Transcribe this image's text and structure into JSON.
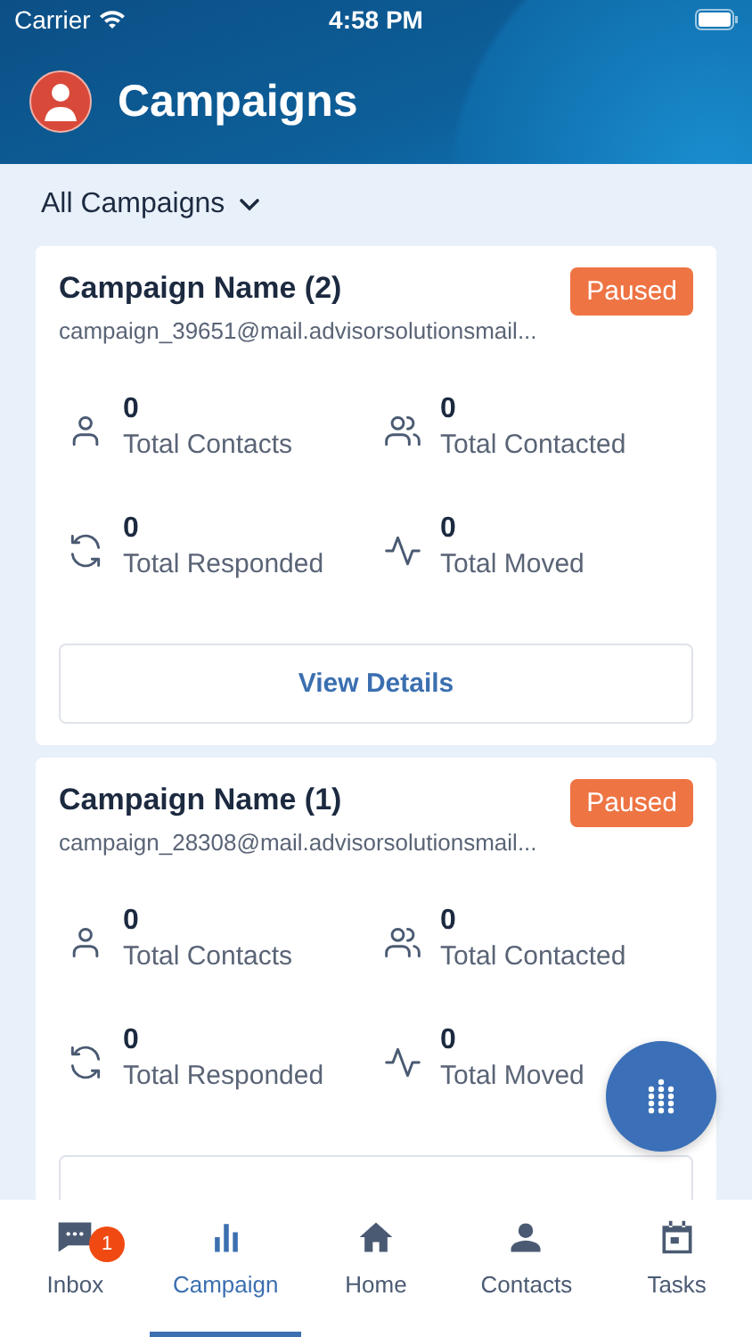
{
  "status_bar": {
    "carrier": "Carrier",
    "time": "4:58 PM"
  },
  "header": {
    "title": "Campaigns"
  },
  "filter": {
    "label": "All Campaigns"
  },
  "campaigns": [
    {
      "name": "Campaign Name (2)",
      "email": "campaign_39651@mail.advisorsolutionsmail...",
      "status": "Paused",
      "stats": [
        {
          "kind": "contact",
          "value": "0",
          "label": "Total Contacts"
        },
        {
          "kind": "contacted",
          "value": "0",
          "label": "Total Contacted"
        },
        {
          "kind": "responded",
          "value": "0",
          "label": "Total Responded"
        },
        {
          "kind": "moved",
          "value": "0",
          "label": "Total Moved"
        }
      ],
      "button": "View Details"
    },
    {
      "name": "Campaign Name (1)",
      "email": "campaign_28308@mail.advisorsolutionsmail...",
      "status": "Paused",
      "stats": [
        {
          "kind": "contact",
          "value": "0",
          "label": "Total Contacts"
        },
        {
          "kind": "contacted",
          "value": "0",
          "label": "Total Contacted"
        },
        {
          "kind": "responded",
          "value": "0",
          "label": "Total Responded"
        },
        {
          "kind": "moved",
          "value": "0",
          "label": "Total Moved"
        }
      ]
    }
  ],
  "tabs": [
    {
      "kind": "inbox",
      "label": "Inbox",
      "badge": "1",
      "selected": false
    },
    {
      "kind": "campaign",
      "label": "Campaign",
      "selected": true
    },
    {
      "kind": "home",
      "label": "Home",
      "selected": false
    },
    {
      "kind": "contacts",
      "label": "Contacts",
      "selected": false
    },
    {
      "kind": "tasks",
      "label": "Tasks",
      "selected": false
    }
  ]
}
